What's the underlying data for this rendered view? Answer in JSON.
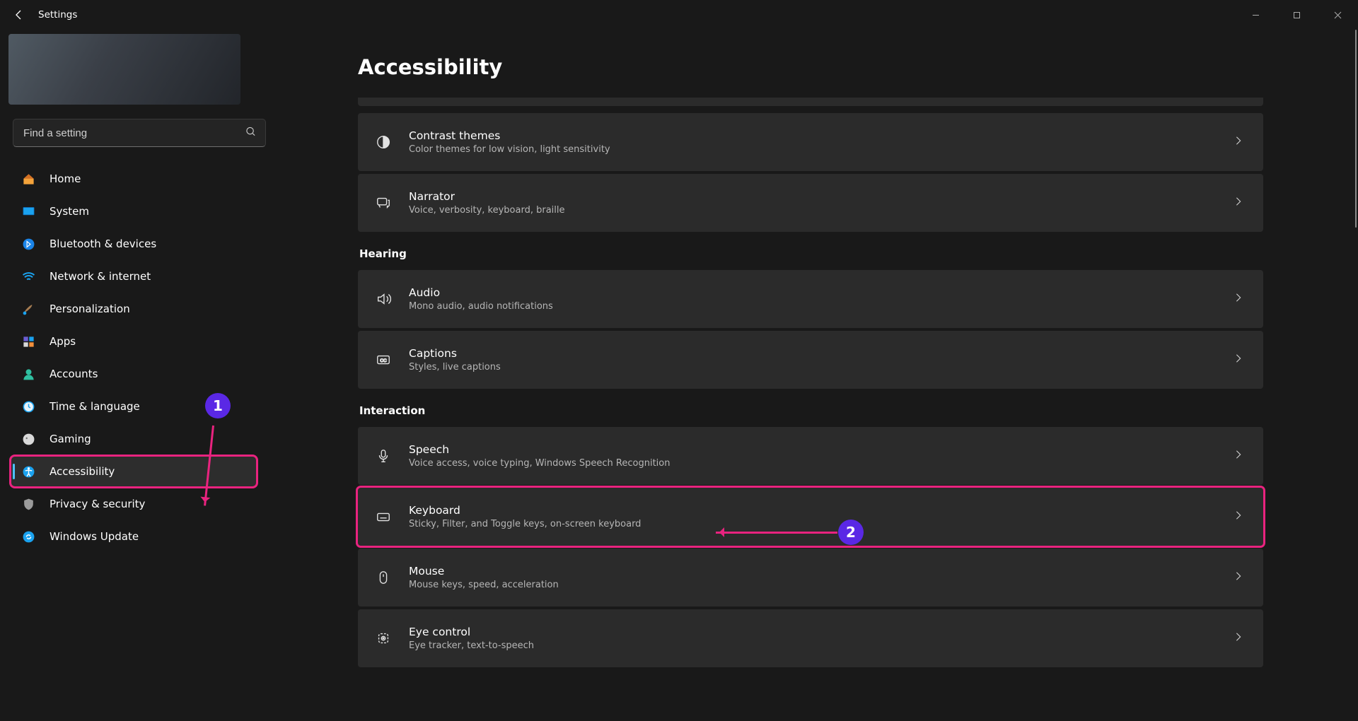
{
  "window": {
    "title": "Settings"
  },
  "search": {
    "placeholder": "Find a setting"
  },
  "nav": {
    "items": [
      {
        "key": "home",
        "label": "Home"
      },
      {
        "key": "system",
        "label": "System"
      },
      {
        "key": "bluetooth",
        "label": "Bluetooth & devices"
      },
      {
        "key": "network",
        "label": "Network & internet"
      },
      {
        "key": "personalization",
        "label": "Personalization"
      },
      {
        "key": "apps",
        "label": "Apps"
      },
      {
        "key": "accounts",
        "label": "Accounts"
      },
      {
        "key": "time",
        "label": "Time & language"
      },
      {
        "key": "gaming",
        "label": "Gaming"
      },
      {
        "key": "accessibility",
        "label": "Accessibility"
      },
      {
        "key": "privacy",
        "label": "Privacy & security"
      },
      {
        "key": "update",
        "label": "Windows Update"
      }
    ],
    "active_key": "accessibility"
  },
  "page": {
    "title": "Accessibility",
    "groups": [
      {
        "header": "",
        "items": [
          {
            "key": "contrast",
            "title": "Contrast themes",
            "sub": "Color themes for low vision, light sensitivity",
            "icon": "half-circle-icon"
          },
          {
            "key": "narrator",
            "title": "Narrator",
            "sub": "Voice, verbosity, keyboard, braille",
            "icon": "chat-icon"
          }
        ]
      },
      {
        "header": "Hearing",
        "items": [
          {
            "key": "audio",
            "title": "Audio",
            "sub": "Mono audio, audio notifications",
            "icon": "sound-icon"
          },
          {
            "key": "captions",
            "title": "Captions",
            "sub": "Styles, live captions",
            "icon": "cc-icon"
          }
        ]
      },
      {
        "header": "Interaction",
        "items": [
          {
            "key": "speech",
            "title": "Speech",
            "sub": "Voice access, voice typing, Windows Speech Recognition",
            "icon": "mic-icon"
          },
          {
            "key": "keyboard",
            "title": "Keyboard",
            "sub": "Sticky, Filter, and Toggle keys, on-screen keyboard",
            "icon": "keyboard-icon"
          },
          {
            "key": "mouse",
            "title": "Mouse",
            "sub": "Mouse keys, speed, acceleration",
            "icon": "mouse-icon"
          },
          {
            "key": "eye",
            "title": "Eye control",
            "sub": "Eye tracker, text-to-speech",
            "icon": "eye-icon"
          }
        ]
      }
    ],
    "highlighted_item": "keyboard"
  },
  "annotations": {
    "marker1": "1",
    "marker2": "2"
  }
}
